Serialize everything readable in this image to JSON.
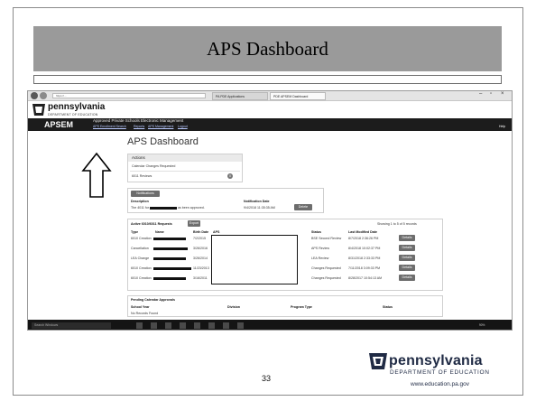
{
  "slide": {
    "title": "APS Dashboard",
    "page_number": "33",
    "footer_logo": {
      "name": "pennsylvania",
      "dept": "DEPARTMENT OF EDUCATION",
      "url": "www.education.pa.gov"
    }
  },
  "browser": {
    "url": "https://...",
    "tabs": [
      "PA PDE Applications",
      "PDE APSEM Dashboard"
    ],
    "logo": {
      "name": "pennsylvania",
      "dept": "DEPARTMENT OF EDUCATION"
    },
    "app_bar": {
      "brand": "APSEM",
      "title": "Approved Private Schools Electronic Management",
      "links": [
        "APS Enrollment Search",
        "Reports",
        "APS Management",
        "Logout"
      ],
      "help": "Help"
    },
    "page_title": "APS Dashboard",
    "actions": {
      "header": "Actions",
      "items": [
        "Calendar Changes Requested",
        "6011 Reviews"
      ],
      "badge": "0"
    },
    "notifications": {
      "button": "Notifications",
      "col_description": "Description",
      "col_date": "Notification Date",
      "row_text": "The 4011 for",
      "row_text_tail": "as been approved.",
      "row_date": "9/4/2018 11:35:35 AM",
      "row_button": "Delete"
    },
    "requests": {
      "header": "Active 6010/6011 Requests",
      "export": "Export",
      "showing": "Showing 1 to 5 of 5 records",
      "columns": [
        "Type",
        "Name",
        "Birth Date",
        "APS",
        "Status",
        "Last Modified Date"
      ],
      "rows": [
        {
          "type": "6010 Creation",
          "birth": "7/2/2015",
          "status": "BSE Second Review",
          "modified": "8/7/2018 2:36:26 PM",
          "action": "Details"
        },
        {
          "type": "Cancellation",
          "birth": "3/26/2016",
          "status": "APS Review",
          "modified": "8/4/2018 10:02:37 PM",
          "action": "Details"
        },
        {
          "type": "LEA Change",
          "birth": "3/26/2014",
          "status": "LEA Review",
          "modified": "8/31/2018 2:33:33 PM",
          "action": "Details"
        },
        {
          "type": "6010 Creation",
          "birth": "11/23/2013",
          "status": "Changes Requested",
          "modified": "7/11/2018 3:09:33 PM",
          "action": "Details"
        },
        {
          "type": "6010 Creation",
          "birth": "3/16/2011",
          "status": "Changes Requested",
          "modified": "8/28/2017 10:54:13 AM",
          "action": "Details"
        }
      ]
    },
    "calendar": {
      "header": "Pending Calendar Approvals",
      "columns": [
        "School Year",
        "Division",
        "Program Type",
        "Status"
      ],
      "empty": "No Records Found"
    },
    "page_footer": "Pennsylvania Department of Education - Approved Private Schools Electronic Management - © 2018",
    "version": "v 1.0.0.0",
    "taskbar_search": "Search Windows",
    "zoom": "90%"
  },
  "colors": {
    "banner": "#9a9a9a",
    "app_bar": "#1c1c1c",
    "taskbar": "#141414",
    "button": "#6d6d6d"
  }
}
